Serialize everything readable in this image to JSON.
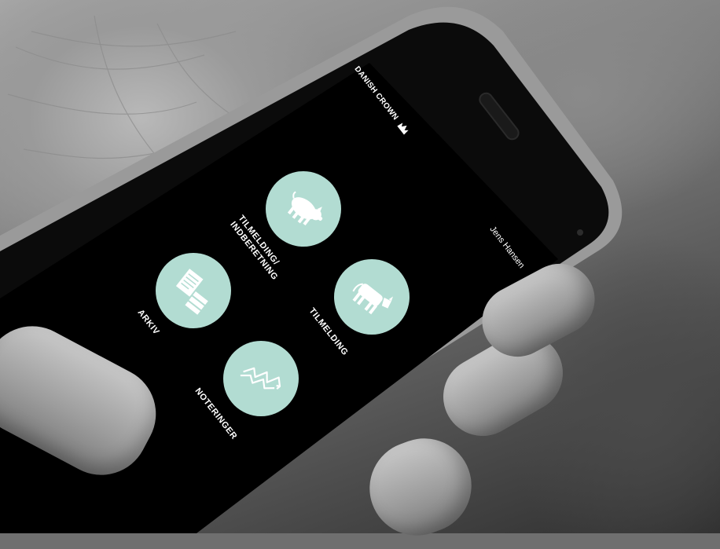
{
  "app": {
    "brand_name": "DANISH CROWN",
    "brand_icon": "crown-icon",
    "user_name": "Jens Hansen"
  },
  "tiles": [
    {
      "label_line1": "TILMELDING/",
      "label_line2": "INDBERETNING",
      "icon": "pig-icon"
    },
    {
      "label": "TILMELDING",
      "icon": "cow-icon"
    },
    {
      "label": "ARKIV",
      "icon": "archive-documents-icon"
    },
    {
      "label": "NOTERINGER",
      "icon": "price-chart-icon"
    }
  ],
  "colors": {
    "tile_bg": "#b2dcd2",
    "screen_bg": "#000000",
    "text": "#ffffff"
  }
}
